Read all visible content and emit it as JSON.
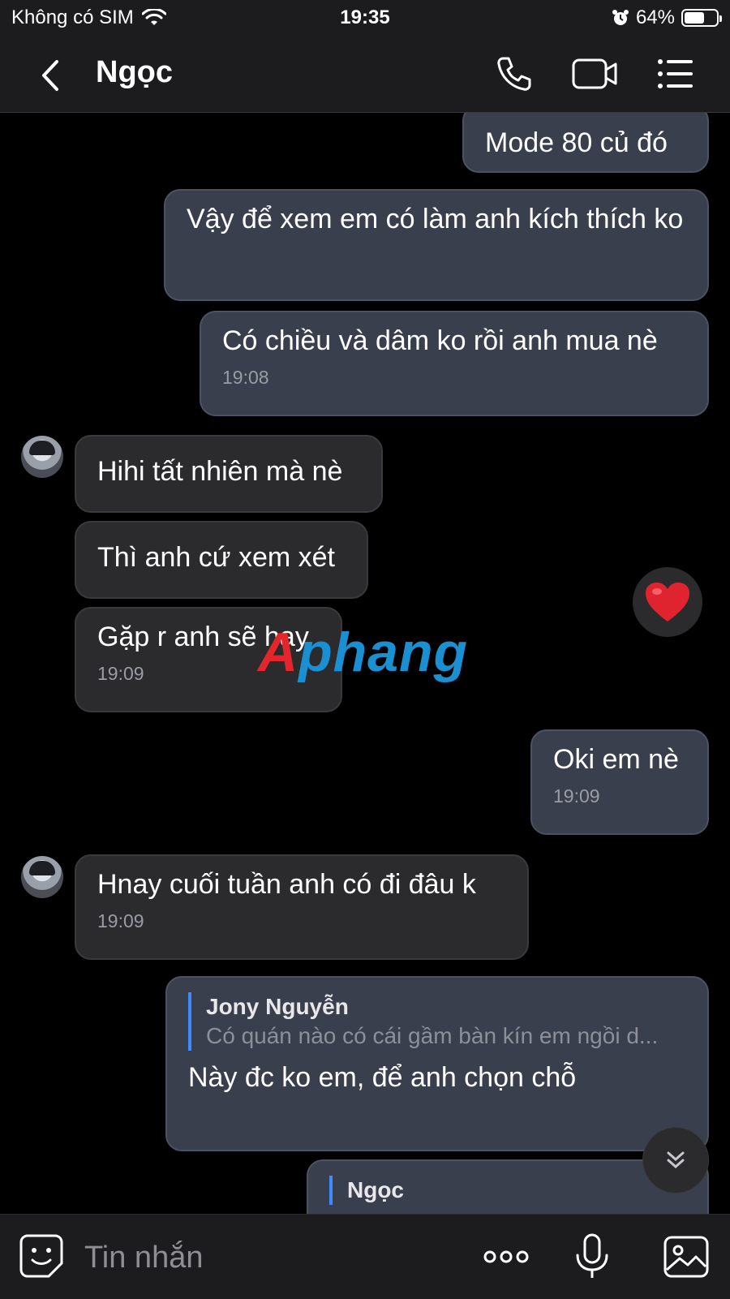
{
  "status_bar": {
    "carrier": "Không có SIM",
    "time": "19:35",
    "battery": "64%",
    "battery_level": 0.64
  },
  "header": {
    "title": "Ngọc",
    "icons": [
      "back-icon",
      "phone-icon",
      "video-icon",
      "menu-icon"
    ]
  },
  "messages": {
    "m1": {
      "text": "Mode 80 củ đó"
    },
    "m2": {
      "text": "Vậy để xem em có làm anh kích thích ko"
    },
    "m3": {
      "text": "Có chiều và dâm ko rồi anh mua nè",
      "time": "19:08"
    },
    "m4": {
      "text": "Hihi tất nhiên mà nè"
    },
    "m5": {
      "text": "Thì anh cứ xem xét"
    },
    "m6": {
      "text": "Gặp r anh sẽ hay",
      "time": "19:09"
    },
    "m7": {
      "text": "Oki em nè",
      "time": "19:09"
    },
    "m8": {
      "text": "Hnay cuối tuần anh có đi đâu k",
      "time": "19:09"
    },
    "m9": {
      "quote_name": "Jony Nguyễn",
      "quote_text": "Có quán nào có cái gầm bàn kín em ngồi d...",
      "text": "Này đc ko em, để anh chọn chỗ"
    },
    "m10": {
      "quote_name": "Ngọc"
    }
  },
  "reaction": "heart",
  "watermark": {
    "accent": "A",
    "rest": "phang"
  },
  "composer": {
    "placeholder": "Tin nhắn",
    "icons": [
      "sticker-icon",
      "more-icon",
      "microphone-icon",
      "image-icon"
    ]
  },
  "colors": {
    "outgoing_bubble": "#3a3f4d",
    "incoming_bubble": "#2b2b2d",
    "quote_bar": "#3d8bff",
    "heart": "#e0242f"
  }
}
